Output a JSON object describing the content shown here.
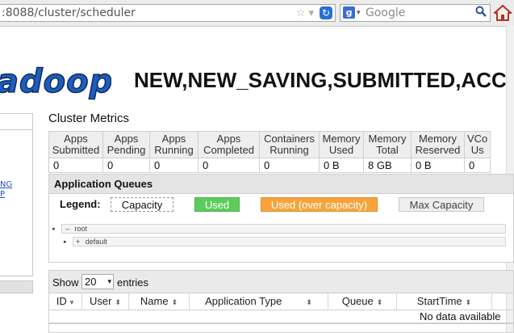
{
  "browser": {
    "url": ":8088/cluster/scheduler",
    "search_placeholder": "Google"
  },
  "header": {
    "logo_text": "adoop",
    "title": "NEW,NEW_SAVING,SUBMITTED,ACC"
  },
  "sidebar": {
    "links": [
      "NG",
      "P"
    ]
  },
  "cluster_metrics": {
    "title": "Cluster Metrics",
    "headers": [
      [
        "Apps",
        "Submitted"
      ],
      [
        "Apps",
        "Pending"
      ],
      [
        "Apps",
        "Running"
      ],
      [
        "Apps",
        "Completed"
      ],
      [
        "Containers",
        "Running"
      ],
      [
        "Memory",
        "Used"
      ],
      [
        "Memory",
        "Total"
      ],
      [
        "Memory",
        "Reserved"
      ],
      [
        "VCo",
        "Us"
      ]
    ],
    "values": [
      "0",
      "0",
      "0",
      "0",
      "0",
      "0 B",
      "8 GB",
      "0 B",
      "0"
    ]
  },
  "application_queues": {
    "title": "Application Queues",
    "legend_label": "Legend:",
    "legend": {
      "capacity": "Capacity",
      "used": "Used",
      "over": "Used (over capacity)",
      "max": "Max Capacity"
    },
    "tree": [
      {
        "toggle": "–",
        "name": "root"
      },
      {
        "toggle": "+",
        "name": "default"
      }
    ]
  },
  "apps_table": {
    "show_label": "Show",
    "page_size": "20",
    "entries_label": "entries",
    "columns": [
      "ID",
      "User",
      "Name",
      "Application Type",
      "Queue",
      "StartTime"
    ],
    "empty_message": "No data available"
  },
  "colors": {
    "used": "#5dcc5d",
    "over_capacity": "#f7a43e",
    "max_capacity": "#eeeeee",
    "logo": "#1f5db8"
  }
}
